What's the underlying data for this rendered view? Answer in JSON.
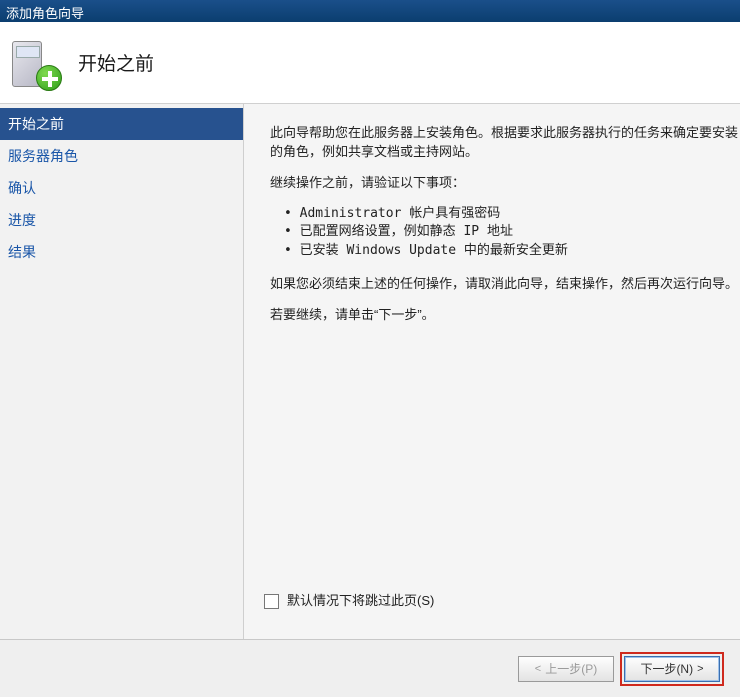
{
  "window": {
    "title": "添加角色向导"
  },
  "header": {
    "title": "开始之前"
  },
  "sidebar": {
    "items": [
      {
        "label": "开始之前",
        "active": true
      },
      {
        "label": "服务器角色",
        "active": false
      },
      {
        "label": "确认",
        "active": false
      },
      {
        "label": "进度",
        "active": false
      },
      {
        "label": "结果",
        "active": false
      }
    ]
  },
  "content": {
    "intro": "此向导帮助您在此服务器上安装角色。根据要求此服务器执行的任务来确定要安装的角色，例如共享文档或主持网站。",
    "verify_heading": "继续操作之前，请验证以下事项：",
    "bullets": [
      "Administrator 帐户具有强密码",
      "已配置网络设置，例如静态 IP 地址",
      "已安装 Windows Update 中的最新安全更新"
    ],
    "cancel_note": "如果您必须结束上述的任何操作，请取消此向导，结束操作，然后再次运行向导。",
    "continue_note": "若要继续，请单击“下一步”。",
    "skip_label": "默认情况下将跳过此页(S)"
  },
  "footer": {
    "prev": "上一步(P)",
    "next": "下一步(N)"
  }
}
